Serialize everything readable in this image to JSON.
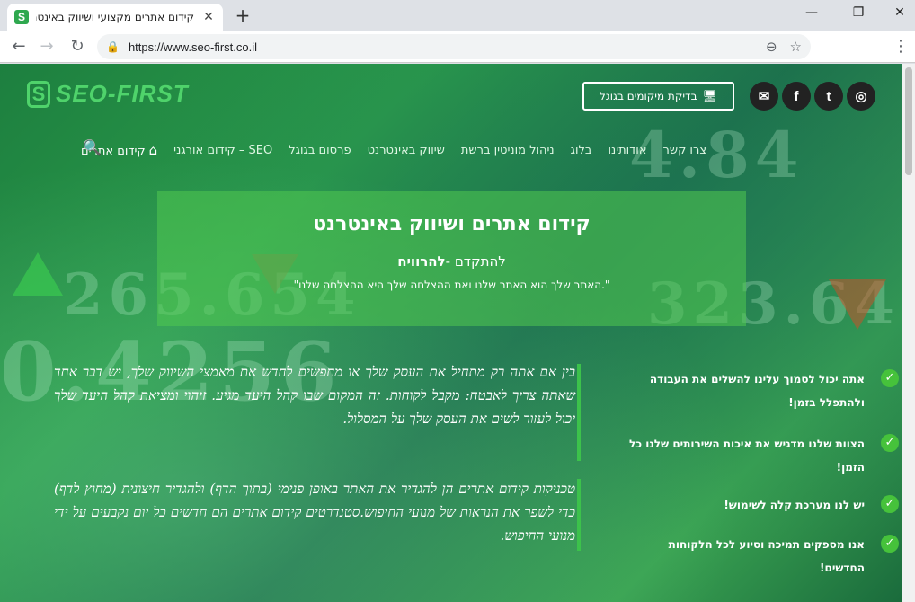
{
  "browser": {
    "tab_title": "קידום אתרים מקצועי ושיווק באינטרנ",
    "tab_favicon": "S",
    "url": "https://www.seo-first.co.il"
  },
  "site": {
    "logo_text": "SEO-FIRST",
    "logo_mark": "S",
    "check_button": "בדיקת מיקומים בגוגל",
    "social": [
      {
        "name": "instagram-icon",
        "glyph": "◎"
      },
      {
        "name": "twitter-icon",
        "glyph": "t"
      },
      {
        "name": "facebook-icon",
        "glyph": "f"
      },
      {
        "name": "email-icon",
        "glyph": "✉"
      }
    ],
    "nav": [
      {
        "label": "קידום אתרים",
        "active": true
      },
      {
        "label": "SEO – קידום אורגני"
      },
      {
        "label": "פרסום בגוגל"
      },
      {
        "label": "שיווק באינטרנט"
      },
      {
        "label": "ניהול מוניטין ברשת"
      },
      {
        "label": "בלוג"
      },
      {
        "label": "אודותינו"
      },
      {
        "label": "צרו קשר"
      }
    ],
    "hero": {
      "title": "קידום אתרים ושיווק באינטרנט",
      "sub_prefix": "להתקדם -",
      "sub_bold": "להרוויח",
      "quote": "\"האתר שלך הוא האתר שלנו ואת ההצלחה שלך היא ההצלחה שלנו.\""
    },
    "paragraphs": [
      "בין אם אתה רק מתחיל את העסק שלך או מחפשים לחדש את מאמצי השיווק שלך, יש דבר אחד שאתה צריך לאבטח: מקבל לקוחות. זה המקום שבו קהל היעד מגיע. זיהוי ומציאת קהל היעד שלך יכול לעזור לשים את העסק שלך על המסלול.",
      "טכניקות קידום אתרים הן להגדיר את האתר באופן פנימי (בתוך הדף) ולהגדיר חיצונית (מחוץ לדף) כדי לשפר את הנראות של מנועי החיפוש.סטנדרטים קידום אתרים הם חדשים כל יום נקבעים על ידי מנועי החיפוש."
    ],
    "features": [
      "אתה יכול לסמוך עלינו להשלים את העבודה ולהתפלל בזמן!",
      "הצוות שלנו מדגיש את איכות השירותים שלנו כל הזמן!",
      "יש לנו מערכת קלה לשימוש!",
      "אנו מספקים תמיכה וסיוע לכל הלקוחות החדשים!"
    ]
  }
}
